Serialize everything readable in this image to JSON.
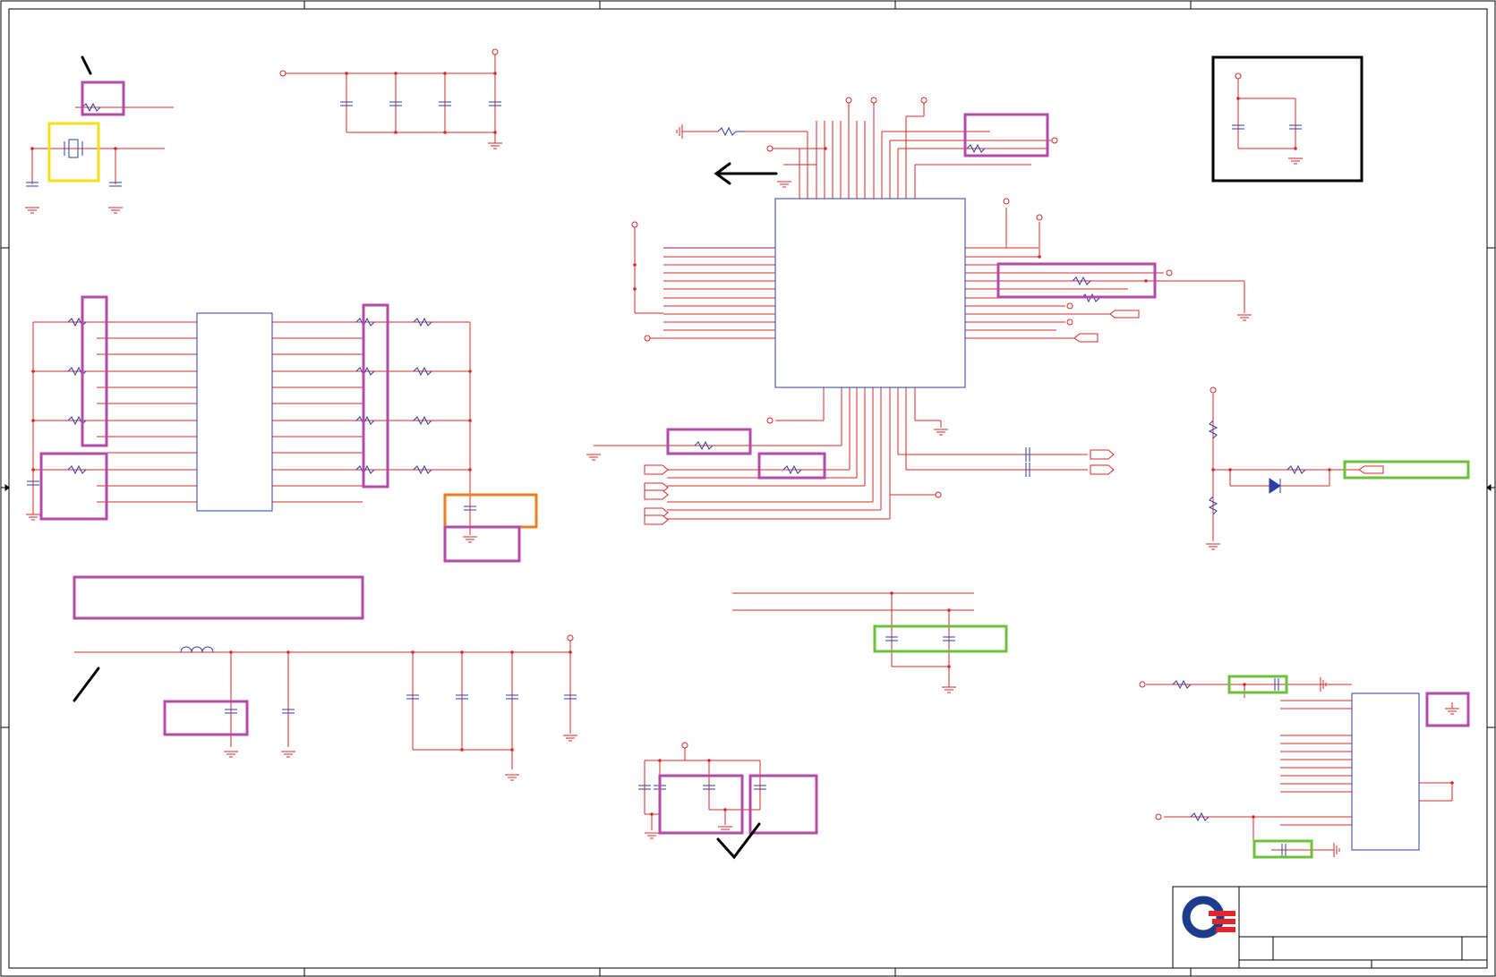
{
  "sheet": {
    "border_color": "#000000",
    "wire_color": "#d42a2a",
    "net_color": "#a0144a",
    "component_color": "#2a3fa8",
    "highlight_colors": {
      "magenta": "#b44aa8",
      "yellow": "#f2e01a",
      "orange": "#ee7d22",
      "green": "#6cc03c"
    },
    "logo": {
      "icon": "company-logo-icon",
      "colors": [
        "#1e3c8c",
        "#e1252d"
      ]
    }
  }
}
